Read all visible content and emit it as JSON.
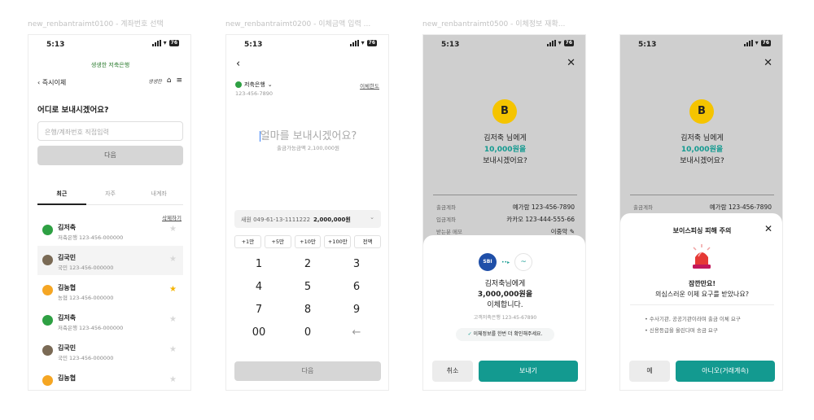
{
  "frames": [
    {
      "title": "new_renbantraimt0100 - 계좌번호 선택"
    },
    {
      "title": "new_renbantraimt0200 - 이체금액 입력 ..."
    },
    {
      "title": "new_renbantraimt0500 - 이체정보 재확..."
    },
    {
      "title": ""
    }
  ],
  "status": {
    "time": "5:13",
    "battery": "76"
  },
  "screen1": {
    "brand": "생생한 저축은행",
    "back_label": "즉시이체",
    "header_logo": "생생한",
    "question": "어디로 보내시겠어요?",
    "search_placeholder": "은행/계좌번호 직접입력",
    "next_label": "다음",
    "tabs": [
      "최근",
      "자주",
      "내계좌"
    ],
    "delete_link": "삭제하기",
    "items": [
      {
        "name": "김저축",
        "account": "저축은행 123-456-000000",
        "starred": false,
        "color": "#2ea043"
      },
      {
        "name": "김국민",
        "account": "국민 123-456-000000",
        "starred": false,
        "color": "#7a6a55"
      },
      {
        "name": "김농협",
        "account": "농협 123-456-000000",
        "starred": true,
        "color": "#f5a623"
      },
      {
        "name": "김저축",
        "account": "저축은행 123-456-000000",
        "starred": false,
        "color": "#2ea043"
      },
      {
        "name": "김국민",
        "account": "국민 123-456-000000",
        "starred": false,
        "color": "#7a6a55"
      },
      {
        "name": "김농협",
        "account": "",
        "starred": false,
        "color": "#f5a623"
      }
    ]
  },
  "screen2": {
    "bank": "저축은행",
    "account": "123-456-7890",
    "limit_link": "이체한도",
    "prompt": "얼마를 보내시겠어요?",
    "balance": "출금가능금액 2,100,000원",
    "source_account": "새원 049-61-13-1111222",
    "source_amount": "2,000,000원",
    "chips": [
      "+1만",
      "+5만",
      "+10만",
      "+100만",
      "전액"
    ],
    "keys": [
      "1",
      "2",
      "3",
      "4",
      "5",
      "6",
      "7",
      "8",
      "9",
      "00",
      "0",
      "←"
    ],
    "next_label": "다음"
  },
  "screen3": {
    "line1": "김저축 님에게",
    "amount": "10,000원을",
    "line3": "보내시겠어요?",
    "rows": [
      {
        "k": "출금계좌",
        "v": "예가람 123-456-7890"
      },
      {
        "k": "입금계좌",
        "v": "카카오 123-444-555-66"
      },
      {
        "k": "받는분 메모",
        "v": "이중악 ✎"
      }
    ],
    "sheet": {
      "from_logo": "SBI",
      "recipient": "김저축님에게",
      "amount": "3,000,000원을",
      "action": "이체합니다.",
      "sub": "고객저축은행 123-45-67890",
      "confirm_note": "이체정보를 한번 더 확인해주세요.",
      "cancel_label": "취소",
      "send_label": "보내기"
    }
  },
  "screen4": {
    "line1": "김저축 님에게",
    "amount": "10,000원을",
    "line3": "보내시겠어요?",
    "row": {
      "k": "출금계좌",
      "v": "예가람 123-456-7890"
    },
    "sheet": {
      "title": "보이스피싱 피해 주의",
      "headline": "잠깐만요!",
      "question": "의심스러운 이체 요구를 받았나요?",
      "bullets": [
        "수사기관, 공공기관이라며 출금 이체 요구",
        "신용등급을 올린다며 송금 요구"
      ],
      "yes_label": "예",
      "no_label": "아니오(거래계속)"
    }
  },
  "colors": {
    "teal": "#139a90",
    "yellow": "#f5c400",
    "star": "#f5b400"
  }
}
